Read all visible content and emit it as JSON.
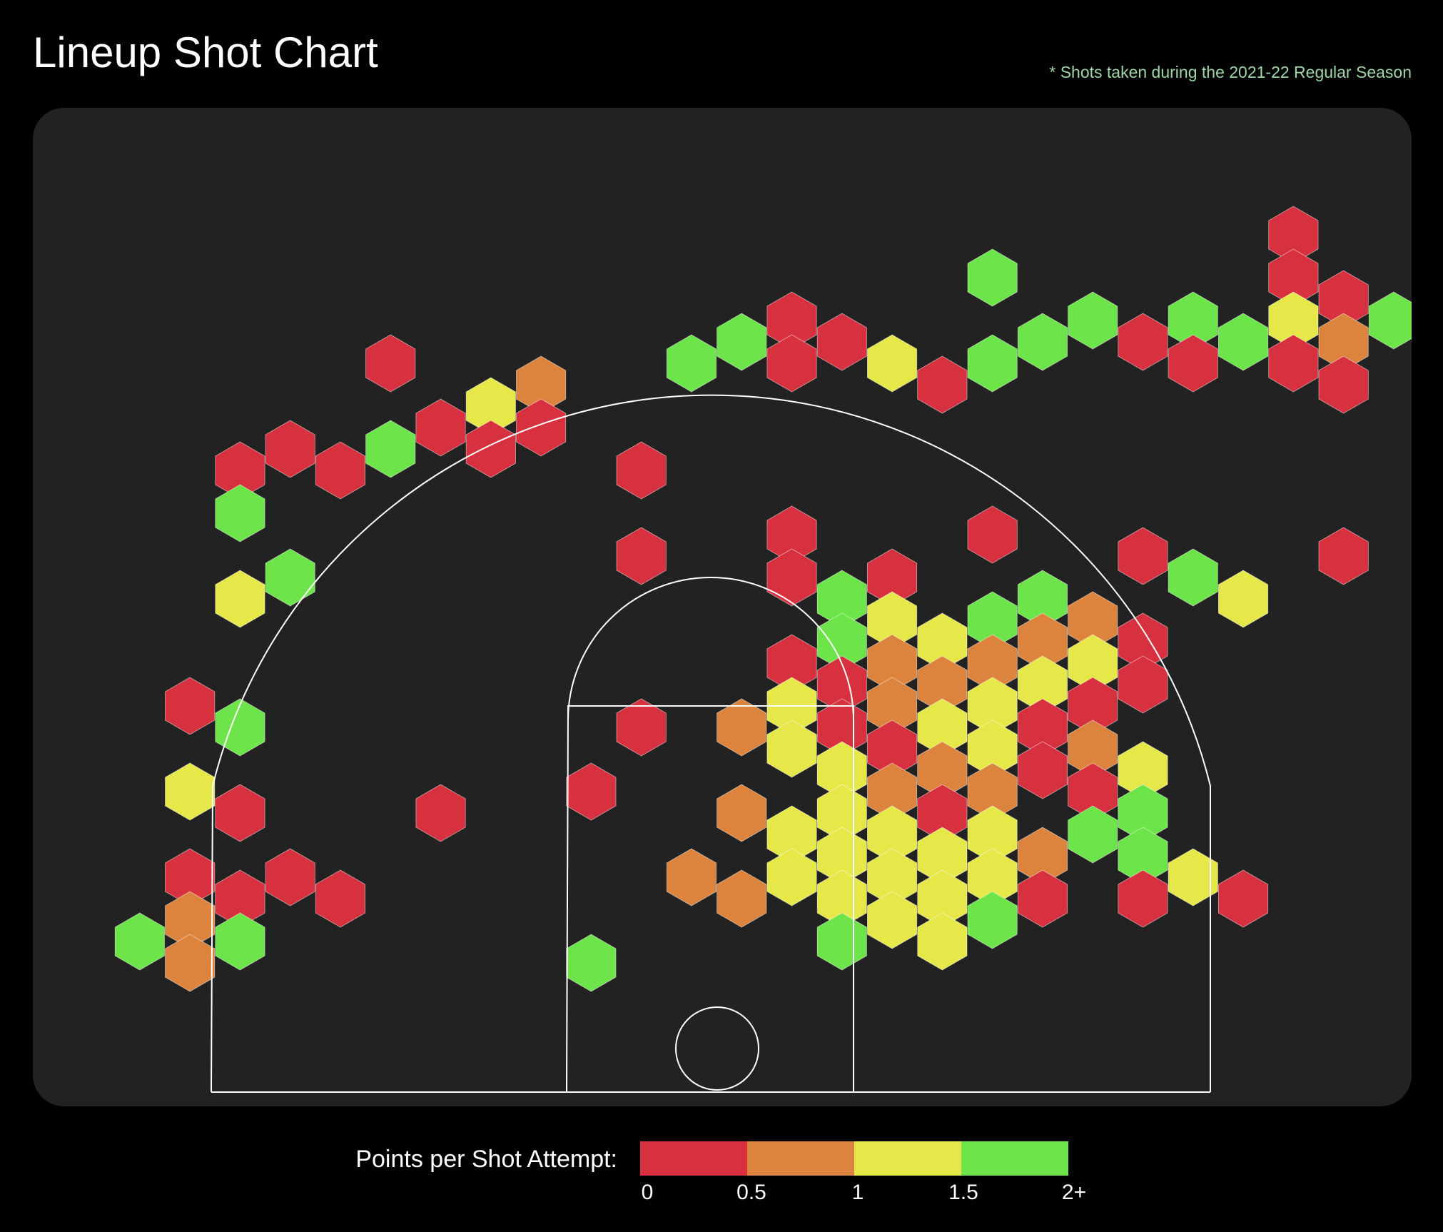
{
  "title": "Lineup Shot Chart",
  "footnote": "* Shots taken during the 2021-22 Regular Season",
  "legend": {
    "label": "Points per Shot Attempt:",
    "ticks": [
      "0",
      "0.5",
      "1",
      "1.5",
      "2+"
    ],
    "colors": [
      "#d7303f",
      "#dc843e",
      "#e6e84a",
      "#6de449"
    ]
  },
  "colors": {
    "background": "#000000",
    "panel": "#222222",
    "court_lines": "#ffffff",
    "footnote": "#9fd6a8"
  },
  "chart_data": {
    "type": "heatmap",
    "kind": "hexbin shot chart on a half basketball court",
    "value_bins": [
      {
        "range": "0-0.5",
        "color": "#d7303f"
      },
      {
        "range": "0.5-1",
        "color": "#dc843e"
      },
      {
        "range": "1-1.5",
        "color": "#e6e84a"
      },
      {
        "range": "1.5-2+",
        "color": "#6de449"
      }
    ],
    "hex_grid_note": "col = horizontal hex index (odd columns offset by half a row), row = vertical hex index from the top of the court; bin 0 = 0-0.5, 1 = 0.5-1, 2 = 1-1.5, 3 = 2+",
    "hexes": [
      [
        26,
        0,
        0
      ],
      [
        26,
        1,
        0
      ],
      [
        20,
        1,
        3
      ],
      [
        27,
        1,
        0
      ],
      [
        15,
        2,
        3
      ],
      [
        16,
        2,
        0
      ],
      [
        17,
        2,
        0
      ],
      [
        21,
        2,
        3
      ],
      [
        22,
        2,
        3
      ],
      [
        23,
        2,
        0
      ],
      [
        24,
        2,
        3
      ],
      [
        25,
        2,
        3
      ],
      [
        26,
        2,
        2
      ],
      [
        27,
        2,
        1
      ],
      [
        28,
        2,
        3
      ],
      [
        8,
        3,
        0
      ],
      [
        14,
        3,
        3
      ],
      [
        16,
        3,
        0
      ],
      [
        18,
        3,
        2
      ],
      [
        19,
        3,
        0
      ],
      [
        20,
        3,
        3
      ],
      [
        24,
        3,
        0
      ],
      [
        11,
        3,
        1
      ],
      [
        26,
        3,
        0
      ],
      [
        27,
        3,
        0
      ],
      [
        29,
        3,
        2
      ],
      [
        9,
        4,
        0
      ],
      [
        10,
        4,
        2
      ],
      [
        11,
        4,
        0
      ],
      [
        29,
        4,
        0
      ],
      [
        30,
        4,
        1
      ],
      [
        6,
        5,
        0
      ],
      [
        10,
        5,
        0
      ],
      [
        31,
        5,
        2
      ],
      [
        32,
        5,
        3
      ],
      [
        5,
        5,
        0
      ],
      [
        7,
        5,
        0
      ],
      [
        8,
        5,
        3
      ],
      [
        13,
        5,
        0
      ],
      [
        33,
        5,
        1
      ],
      [
        34,
        5,
        3
      ],
      [
        5,
        6,
        3
      ],
      [
        34,
        6,
        0
      ],
      [
        13,
        7,
        0
      ],
      [
        16,
        7,
        0
      ],
      [
        20,
        7,
        0
      ],
      [
        23,
        7,
        0
      ],
      [
        27,
        7,
        0
      ],
      [
        34,
        7,
        3
      ],
      [
        5,
        8,
        2
      ],
      [
        6,
        8,
        3
      ],
      [
        17,
        8,
        3
      ],
      [
        18,
        8,
        0
      ],
      [
        21,
        8,
        3
      ],
      [
        24,
        8,
        3
      ],
      [
        25,
        8,
        2
      ],
      [
        33,
        8,
        3
      ],
      [
        16,
        8,
        0
      ],
      [
        17,
        9,
        3
      ],
      [
        18,
        9,
        2
      ],
      [
        19,
        9,
        2
      ],
      [
        20,
        9,
        3
      ],
      [
        21,
        9,
        1
      ],
      [
        22,
        9,
        1
      ],
      [
        23,
        9,
        0
      ],
      [
        32,
        9,
        0
      ],
      [
        33,
        9,
        1
      ],
      [
        16,
        10,
        0
      ],
      [
        17,
        10,
        0
      ],
      [
        18,
        10,
        1
      ],
      [
        19,
        10,
        1
      ],
      [
        20,
        10,
        1
      ],
      [
        21,
        10,
        2
      ],
      [
        22,
        10,
        2
      ],
      [
        23,
        10,
        0
      ],
      [
        34,
        10,
        2
      ],
      [
        4,
        11,
        0
      ],
      [
        15,
        11,
        1
      ],
      [
        16,
        11,
        2
      ],
      [
        17,
        11,
        0
      ],
      [
        18,
        11,
        1
      ],
      [
        19,
        11,
        2
      ],
      [
        20,
        11,
        2
      ],
      [
        21,
        11,
        0
      ],
      [
        22,
        11,
        0
      ],
      [
        33,
        11,
        0
      ],
      [
        5,
        11,
        3
      ],
      [
        13,
        11,
        0
      ],
      [
        16,
        12,
        2
      ],
      [
        17,
        12,
        2
      ],
      [
        18,
        12,
        0
      ],
      [
        19,
        12,
        1
      ],
      [
        20,
        12,
        2
      ],
      [
        21,
        12,
        0
      ],
      [
        22,
        12,
        1
      ],
      [
        23,
        12,
        2
      ],
      [
        29,
        12,
        0
      ],
      [
        34,
        12,
        2
      ],
      [
        35,
        12,
        3
      ],
      [
        4,
        13,
        2
      ],
      [
        12,
        13,
        0
      ],
      [
        15,
        13,
        1
      ],
      [
        17,
        13,
        2
      ],
      [
        18,
        13,
        1
      ],
      [
        19,
        13,
        0
      ],
      [
        20,
        13,
        1
      ],
      [
        22,
        13,
        0
      ],
      [
        23,
        13,
        3
      ],
      [
        33,
        13,
        0
      ],
      [
        34,
        13,
        3
      ],
      [
        5,
        13,
        0
      ],
      [
        9,
        13,
        0
      ],
      [
        16,
        14,
        2
      ],
      [
        17,
        14,
        2
      ],
      [
        18,
        14,
        2
      ],
      [
        19,
        14,
        2
      ],
      [
        20,
        14,
        2
      ],
      [
        21,
        14,
        1
      ],
      [
        22,
        14,
        3
      ],
      [
        23,
        14,
        3
      ],
      [
        34,
        14,
        2
      ],
      [
        35,
        14,
        0
      ],
      [
        4,
        15,
        0
      ],
      [
        5,
        15,
        0
      ],
      [
        6,
        15,
        0
      ],
      [
        7,
        15,
        0
      ],
      [
        14,
        15,
        1
      ],
      [
        15,
        15,
        1
      ],
      [
        16,
        15,
        2
      ],
      [
        17,
        15,
        2
      ],
      [
        18,
        15,
        2
      ],
      [
        19,
        15,
        2
      ],
      [
        20,
        15,
        2
      ],
      [
        21,
        15,
        0
      ],
      [
        23,
        15,
        0
      ],
      [
        24,
        15,
        2
      ],
      [
        25,
        15,
        0
      ],
      [
        33,
        15,
        1
      ],
      [
        34,
        15,
        3
      ],
      [
        3,
        16,
        3
      ],
      [
        4,
        16,
        1
      ],
      [
        5,
        16,
        3
      ],
      [
        17,
        16,
        3
      ],
      [
        18,
        16,
        2
      ],
      [
        19,
        16,
        2
      ],
      [
        20,
        16,
        3
      ],
      [
        34,
        16,
        1
      ],
      [
        4,
        17,
        1
      ],
      [
        12,
        17,
        3
      ],
      [
        35,
        17,
        3
      ]
    ]
  }
}
